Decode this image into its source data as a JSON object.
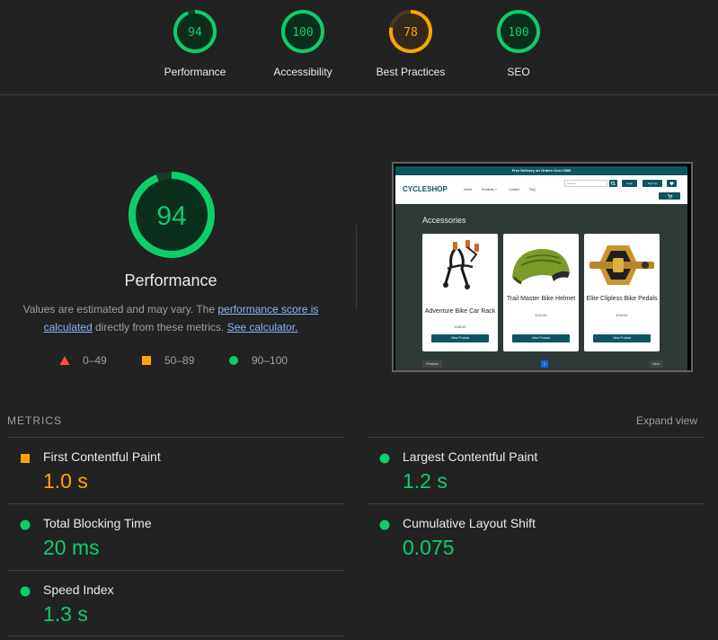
{
  "colors": {
    "pass": "#0cce6b",
    "average": "#ffa400",
    "fail": "#ff4e42",
    "background": "#222222"
  },
  "summary_gauges": [
    {
      "score": "94",
      "score_fraction": 0.94,
      "label": "Performance",
      "rating": "pass"
    },
    {
      "score": "100",
      "score_fraction": 1.0,
      "label": "Accessibility",
      "rating": "pass"
    },
    {
      "score": "78",
      "score_fraction": 0.78,
      "label": "Best Practices",
      "rating": "average"
    },
    {
      "score": "100",
      "score_fraction": 1.0,
      "label": "SEO",
      "rating": "pass"
    }
  ],
  "performance": {
    "score": "94",
    "score_fraction": 0.94,
    "title": "Performance",
    "desc_1": "Values are estimated and may vary. The ",
    "link_1": "performance score is calculated",
    "desc_2": " directly from these metrics. ",
    "link_2": "See calculator."
  },
  "legend": [
    {
      "shape": "triangle",
      "range": "0–49"
    },
    {
      "shape": "square",
      "range": "50–89"
    },
    {
      "shape": "circle",
      "range": "90–100"
    }
  ],
  "screenshot": {
    "banner": "Free Delivery on Orders Over £500",
    "logo": "CYCLESHOP",
    "nav": [
      "Home",
      "Products ˅",
      "Contact",
      "FAQ"
    ],
    "search_placeholder": "Search",
    "login": "Login",
    "signup": "Sign Up",
    "heading": "Accessories",
    "products": [
      {
        "name": "Adventure Bike Car Rack",
        "price": "£180.00",
        "button": "View Product"
      },
      {
        "name": "Trail Master Bike Helmet",
        "price": "£120.00",
        "button": "View Product"
      },
      {
        "name": "Elite Clipless Bike Pedals",
        "price": "£140.00",
        "button": "View Product"
      }
    ],
    "pagination": {
      "prev": "Previous",
      "page": "1",
      "next": "Next"
    }
  },
  "metrics": {
    "header": "METRICS",
    "expand": "Expand view",
    "items": [
      {
        "label": "First Contentful Paint",
        "value": "1.0 s",
        "rating": "average"
      },
      {
        "label": "Largest Contentful Paint",
        "value": "1.2 s",
        "rating": "pass"
      },
      {
        "label": "Total Blocking Time",
        "value": "20 ms",
        "rating": "pass"
      },
      {
        "label": "Cumulative Layout Shift",
        "value": "0.075",
        "rating": "pass"
      },
      {
        "label": "Speed Index",
        "value": "1.3 s",
        "rating": "pass"
      }
    ]
  }
}
